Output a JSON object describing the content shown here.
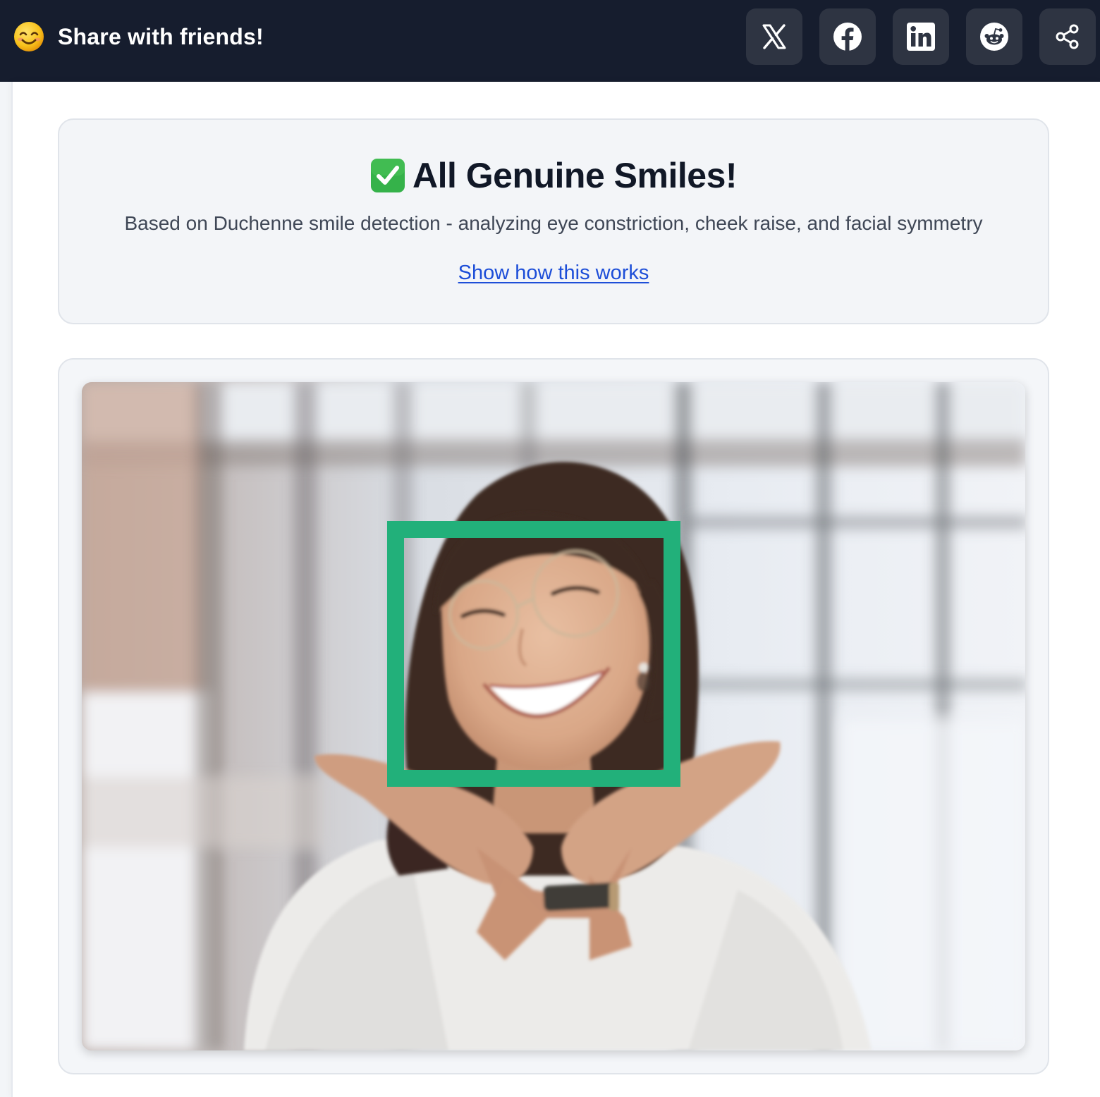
{
  "header": {
    "title": "Share with friends!",
    "logo_icon": "smiling-face-emoji",
    "share_buttons": [
      {
        "name": "x-twitter",
        "icon": "x-logo-icon"
      },
      {
        "name": "facebook",
        "icon": "facebook-logo-icon"
      },
      {
        "name": "linkedin",
        "icon": "linkedin-logo-icon"
      },
      {
        "name": "reddit",
        "icon": "reddit-logo-icon"
      },
      {
        "name": "share",
        "icon": "share-nodes-icon"
      }
    ]
  },
  "result": {
    "status_icon": "check-mark-button-emoji",
    "title": "All Genuine Smiles!",
    "subtitle": "Based on Duchenne smile detection - analyzing eye constriction, cheek raise, and facial symmetry",
    "link": "Show how this works"
  },
  "analysis_image": {
    "subject": "smiling woman with glasses resting chin on hands",
    "detection_box_color": "#22b07a",
    "detections": 1
  },
  "colors": {
    "header_bg": "#161d2e",
    "button_bg": "#2e3442",
    "link": "#1d4ed8",
    "panel_bg": "#f3f5f8"
  }
}
